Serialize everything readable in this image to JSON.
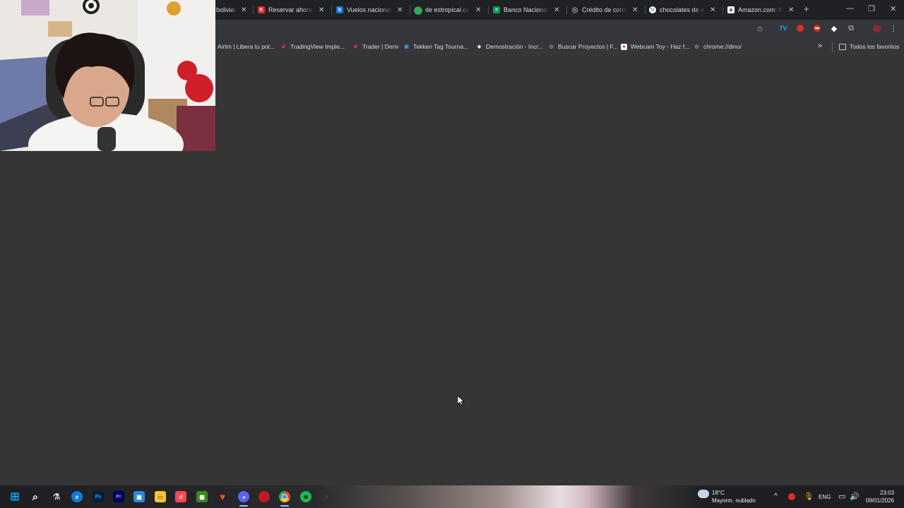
{
  "browser": {
    "tabs": [
      {
        "title": "bolivian",
        "favicon_color": "#5f6368",
        "favicon_glyph": ""
      },
      {
        "title": "Reservar ahora: Cl",
        "favicon_color": "#d93025",
        "favicon_glyph": "K"
      },
      {
        "title": "Vuelos nacionales",
        "favicon_color": "#1a73e8",
        "favicon_glyph": "b"
      },
      {
        "title": "de estropical.com",
        "favicon_color": "#34a853",
        "favicon_glyph": "•"
      },
      {
        "title": "Banco Nacional d",
        "favicon_color": "#0f9d58",
        "favicon_glyph": "="
      },
      {
        "title": "Crédito de consu",
        "favicon_color": "#9aa0a6",
        "favicon_glyph": "◎"
      },
      {
        "title": "chocolates de alc",
        "favicon_color": "#ffffff",
        "favicon_glyph": "G"
      },
      {
        "title": "Amazon.com: Nu",
        "favicon_color": "#ffffff",
        "favicon_glyph": "a"
      }
    ],
    "new_tab_label": "+",
    "window_controls": {
      "minimize": "—",
      "restore": "❐",
      "close": "✕"
    },
    "bookmarks": [
      {
        "label": "Airtm | Libera tu pot...",
        "icon": "airtm-icon",
        "color": "#5f6368",
        "glyph": ""
      },
      {
        "label": "TradingView Imple...",
        "icon": "deriv-icon",
        "color": "#ff444f",
        "glyph": "d"
      },
      {
        "label": "Trader | Deriv",
        "icon": "deriv-icon",
        "color": "#ff444f",
        "glyph": "d"
      },
      {
        "label": "Tekken Tag Tourna...",
        "icon": "tekken-icon",
        "color": "#4a90c2",
        "glyph": "▣"
      },
      {
        "label": "Demostración - Incr...",
        "icon": "shield-icon",
        "color": "#dadce0",
        "glyph": "◆"
      },
      {
        "label": "Buscar Proyectos | F...",
        "icon": "globe-icon",
        "color": "#9aa0a6",
        "glyph": "◎"
      },
      {
        "label": "Webcam Toy - Haz f...",
        "icon": "webcamtoy-icon",
        "color": "#ffffff",
        "glyph": "●"
      },
      {
        "label": "chrome://dino/",
        "icon": "globe-icon",
        "color": "#9aa0a6",
        "glyph": "◎"
      }
    ],
    "bookmarks_more": "»",
    "all_bookmarks_label": "Todos los favoritos"
  },
  "taskbar": {
    "apps": [
      {
        "name": "windows-start-icon",
        "color": "#00a4ef",
        "glyph": "⊞"
      },
      {
        "name": "search-icon",
        "color": "transparent",
        "glyph": "⌕"
      },
      {
        "name": "task-view-icon",
        "color": "transparent",
        "glyph": "⚗"
      },
      {
        "name": "edge-icon",
        "color": "#0f7cd9",
        "glyph": "e"
      },
      {
        "name": "photoshop-icon",
        "color": "#001e36",
        "glyph": "Ps"
      },
      {
        "name": "premiere-icon",
        "color": "#00005b",
        "glyph": "Pr"
      },
      {
        "name": "store-icon",
        "color": "#2b88d8",
        "glyph": "▦"
      },
      {
        "name": "file-explorer-icon",
        "color": "#f8c436",
        "glyph": "▭"
      },
      {
        "name": "deriv-app-icon",
        "color": "#ff444f",
        "glyph": "d"
      },
      {
        "name": "minecraft-icon",
        "color": "#3c8527",
        "glyph": "▩"
      },
      {
        "name": "brave-icon",
        "color": "#fb542b",
        "glyph": "▼"
      },
      {
        "name": "discord-icon",
        "color": "#5865f2",
        "glyph": "◕"
      },
      {
        "name": "app-icon-red",
        "color": "#c0191f",
        "glyph": "●"
      },
      {
        "name": "chrome-icon",
        "color": "#ea4335",
        "glyph": "◉"
      },
      {
        "name": "spotify-icon",
        "color": "#1db954",
        "glyph": "≋"
      },
      {
        "name": "obs-icon",
        "color": "#302e31",
        "glyph": "◌"
      }
    ],
    "weather": {
      "temperature": "18°C",
      "condition": "Mayorm. nublado"
    },
    "tray": {
      "chevron": "^",
      "language": "ENG"
    },
    "clock": {
      "time": "23:03",
      "date": "09/01/2026"
    }
  }
}
